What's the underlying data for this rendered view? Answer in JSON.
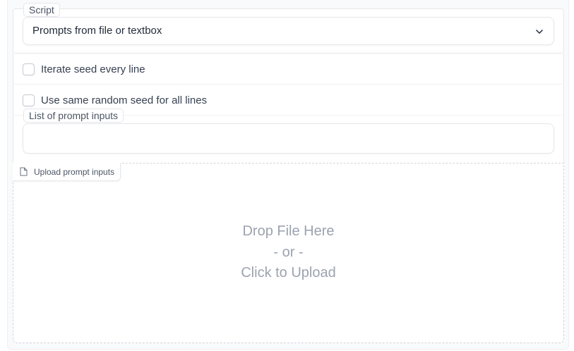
{
  "script": {
    "label": "Script",
    "selected": "Prompts from file or textbox"
  },
  "options": {
    "iterate_seed": {
      "label": "Iterate seed every line",
      "checked": false
    },
    "same_seed": {
      "label": "Use same random seed for all lines",
      "checked": false
    },
    "prompt_list": {
      "label": "List of prompt inputs",
      "value": ""
    }
  },
  "upload": {
    "label": "Upload prompt inputs",
    "drop_line1": "Drop File Here",
    "drop_line2": "- or -",
    "drop_line3": "Click to Upload"
  },
  "icons": {
    "dropdown": "chevron-down-icon",
    "upload": "file-icon"
  },
  "colors": {
    "border": "#e5e7eb",
    "muted_text": "#9ca3af",
    "text": "#1f2937"
  }
}
